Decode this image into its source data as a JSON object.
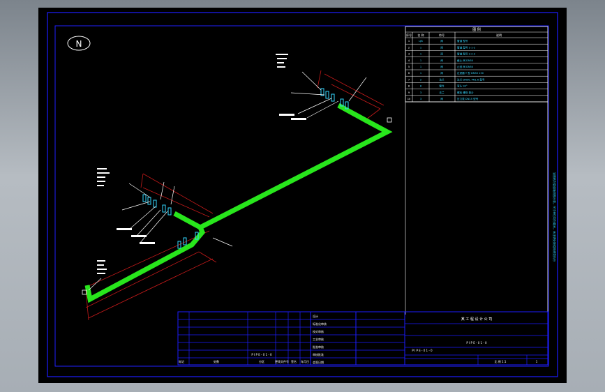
{
  "north_symbol": "N",
  "legend": {
    "title": "图 例",
    "headers": [
      "序号",
      "名 称",
      "符号",
      "说明"
    ],
    "rows": [
      [
        "1",
        "LJB",
        "阀",
        "管道 型号"
      ],
      [
        "2",
        "1",
        "阀",
        "管道 型号 1-1-2"
      ],
      [
        "3",
        "1",
        "阀",
        "管道 型号 2-2-3"
      ],
      [
        "4",
        "1",
        "阀",
        "截止 阀 DN50"
      ],
      [
        "5",
        "1",
        "阀",
        "止回 阀 DN50"
      ],
      [
        "6",
        "1",
        "阀",
        "过滤器 Y 型 DN50 150"
      ],
      [
        "7",
        "2",
        "法兰",
        "法兰 DN50, PN1.6 型号"
      ],
      [
        "8",
        "8",
        "管件",
        "弯头 90°"
      ],
      [
        "9",
        "3",
        "法兰",
        "螺栓 螺母 垫片"
      ],
      [
        "10",
        "3",
        "阀",
        "压力表 DN15 型号"
      ]
    ]
  },
  "title_block": {
    "company": "某 工 程 设 计 公 司",
    "drawing_name": "P I P E - 0 1 - 0",
    "drawing_number": "P I P E - 0 1 - 0",
    "left_columns": [
      "标记",
      "处数",
      "分区",
      "更改文件号",
      "签名",
      "年月日"
    ],
    "mid_labels": [
      "设计",
      "标准化审核",
      "校对审核",
      "工艺审核",
      "批准审核",
      "审核批准",
      "会签日期"
    ],
    "mid_note": "P I P E - 0 1 - 0",
    "footer_left": [
      "共",
      "张",
      "第",
      "张"
    ],
    "footer_right": "比 例 1:1",
    "sheet": "1"
  },
  "side_note": "该图纸为管道轴测图示意，尺寸单位均为毫米，未注明处按相关规范执行"
}
